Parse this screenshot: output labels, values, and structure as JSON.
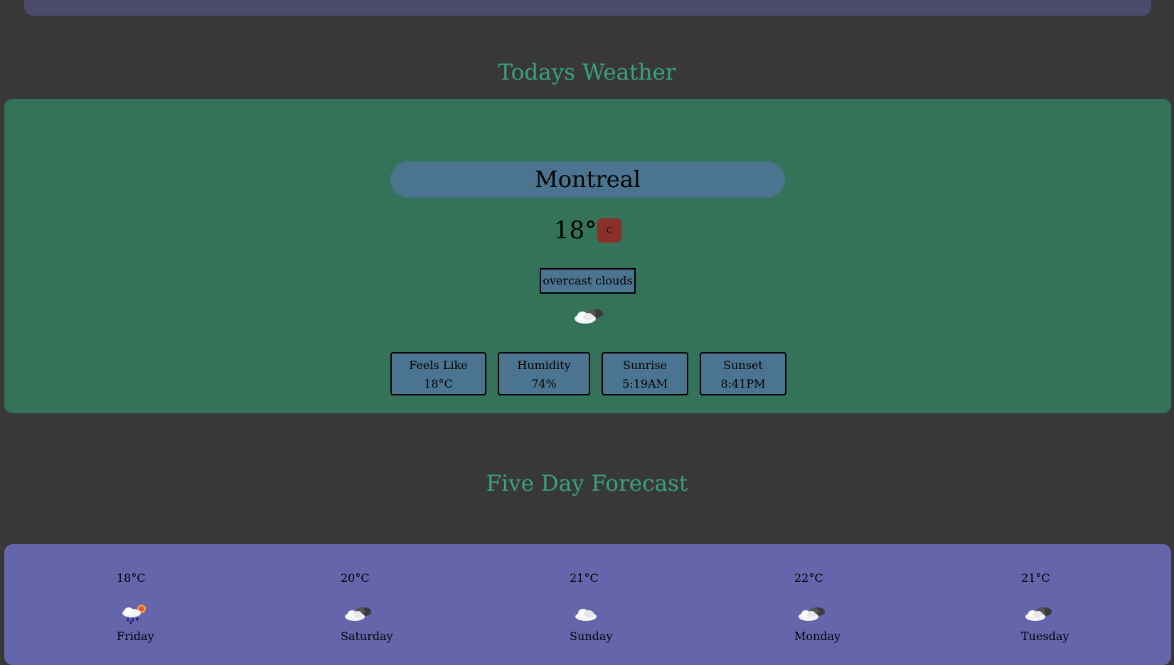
{
  "today": {
    "heading": "Todays Weather",
    "city": "Montreal",
    "temperature": "18°",
    "unit_toggle": "C",
    "description": "overcast clouds",
    "icon": "overcast-clouds-icon",
    "stats": [
      {
        "label": "Feels Like",
        "value": "18°C"
      },
      {
        "label": "Humidity",
        "value": "74%"
      },
      {
        "label": "Sunrise",
        "value": "5:19AM"
      },
      {
        "label": "Sunset",
        "value": "8:41PM"
      }
    ]
  },
  "forecast": {
    "heading": "Five Day Forecast",
    "days": [
      {
        "temp": "18°C",
        "name": "Friday",
        "icon": "rain-sun-icon"
      },
      {
        "temp": "20°C",
        "name": "Saturday",
        "icon": "overcast-clouds-icon"
      },
      {
        "temp": "21°C",
        "name": "Sunday",
        "icon": "cloud-icon"
      },
      {
        "temp": "22°C",
        "name": "Monday",
        "icon": "overcast-clouds-icon"
      },
      {
        "temp": "21°C",
        "name": "Tuesday",
        "icon": "overcast-clouds-icon"
      }
    ]
  },
  "colors": {
    "background": "#383838",
    "accent_heading": "#3aa17a",
    "today_panel": "#34735a",
    "info_box": "#4a748f",
    "unit_button": "#8a3028",
    "forecast_panel": "#6565ac",
    "top_bar": "#4b4a6b"
  }
}
